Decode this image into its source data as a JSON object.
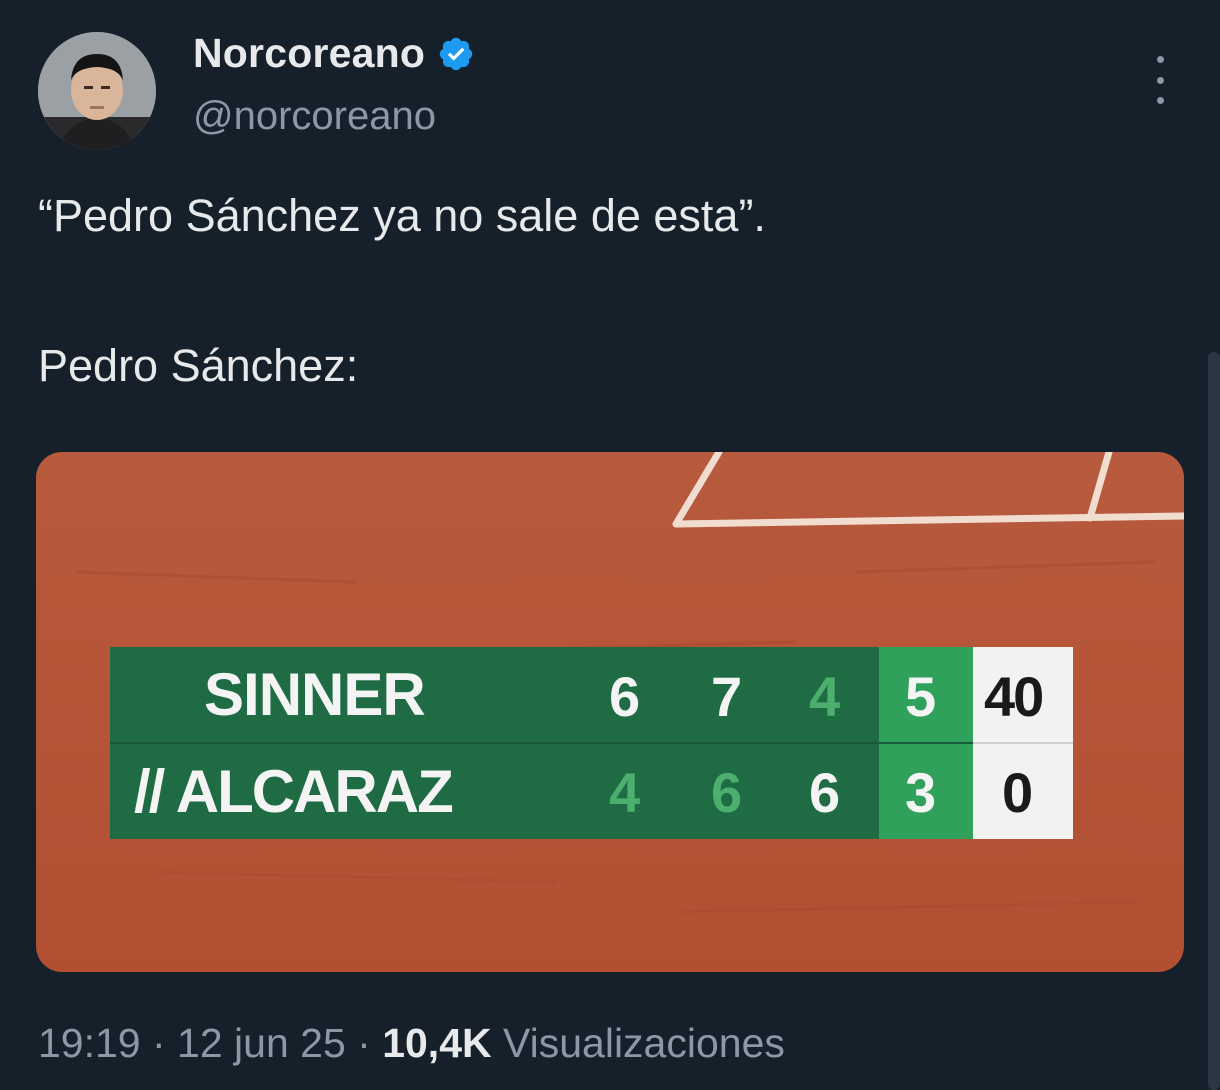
{
  "author": {
    "display_name": "Norcoreano",
    "handle": "@norcoreano",
    "avatar_icon": "profile-photo",
    "verified_icon": "verified-badge-icon",
    "verified_color": "#1d9bf0"
  },
  "tweet": {
    "line1": "“Pedro Sánchez ya no sale de esta”.",
    "line2": "Pedro Sánchez:"
  },
  "media": {
    "court_color": "#b5533a",
    "scoreboard": {
      "players": [
        {
          "name": "SINNER",
          "sets": [
            "6",
            "7",
            "4"
          ],
          "current_set": "5",
          "points": "40"
        },
        {
          "name": "// ALCARAZ",
          "sets": [
            "4",
            "6",
            "6"
          ],
          "current_set": "3",
          "points": "0"
        }
      ],
      "board_color": "#1e6b44",
      "current_set_color": "#2fa15a",
      "dim_digit_color": "#4caf6e"
    }
  },
  "footer": {
    "time": "19:19",
    "separator": " · ",
    "date": "12 jun 25",
    "views_count": "10,4K",
    "views_label": " Visualizaciones"
  }
}
